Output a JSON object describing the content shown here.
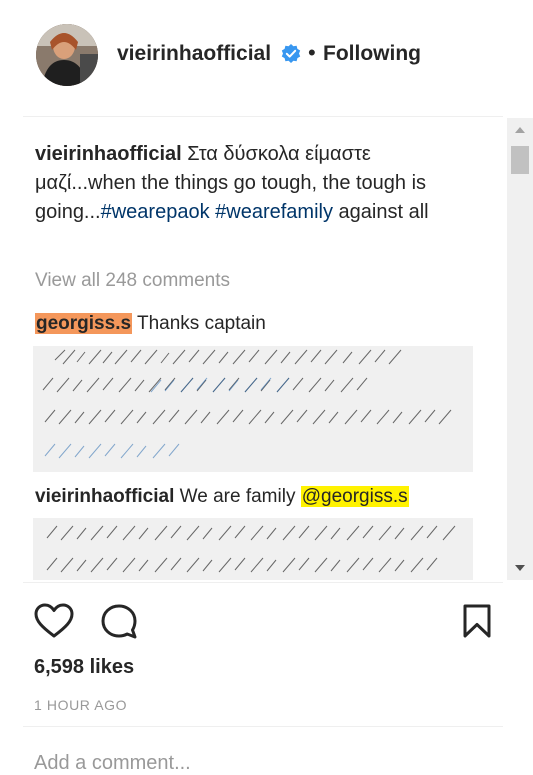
{
  "header": {
    "username": "vieirinhaofficial",
    "separator": "•",
    "follow_status": "Following"
  },
  "caption": {
    "author": "vieirinhaofficial",
    "text_before": "Στα δύσκολα είμαστε μαζί...when the things go tough, the tough is going...",
    "tags": [
      "#wearepaok",
      "#wearefamily"
    ],
    "text_after": "against all"
  },
  "view_all_comments": "View all 248 comments",
  "comments": [
    {
      "author": "georgiss.s",
      "text": "Thanks captain"
    },
    {
      "author": "vieirinhaofficial",
      "text": "We are family ",
      "mention": "@georgiss.s"
    }
  ],
  "actions": {
    "like_icon": "heart-outline-icon",
    "comment_icon": "speech-bubble-icon",
    "save_icon": "bookmark-outline-icon"
  },
  "likes": "6,598 likes",
  "timestamp": "1 HOUR AGO",
  "add_comment": {
    "placeholder": "Add a comment..."
  },
  "colors": {
    "hashtag": "#003569",
    "highlight_orange": "#f4975b",
    "highlight_yellow": "#fff200",
    "verified": "#3897f0"
  }
}
